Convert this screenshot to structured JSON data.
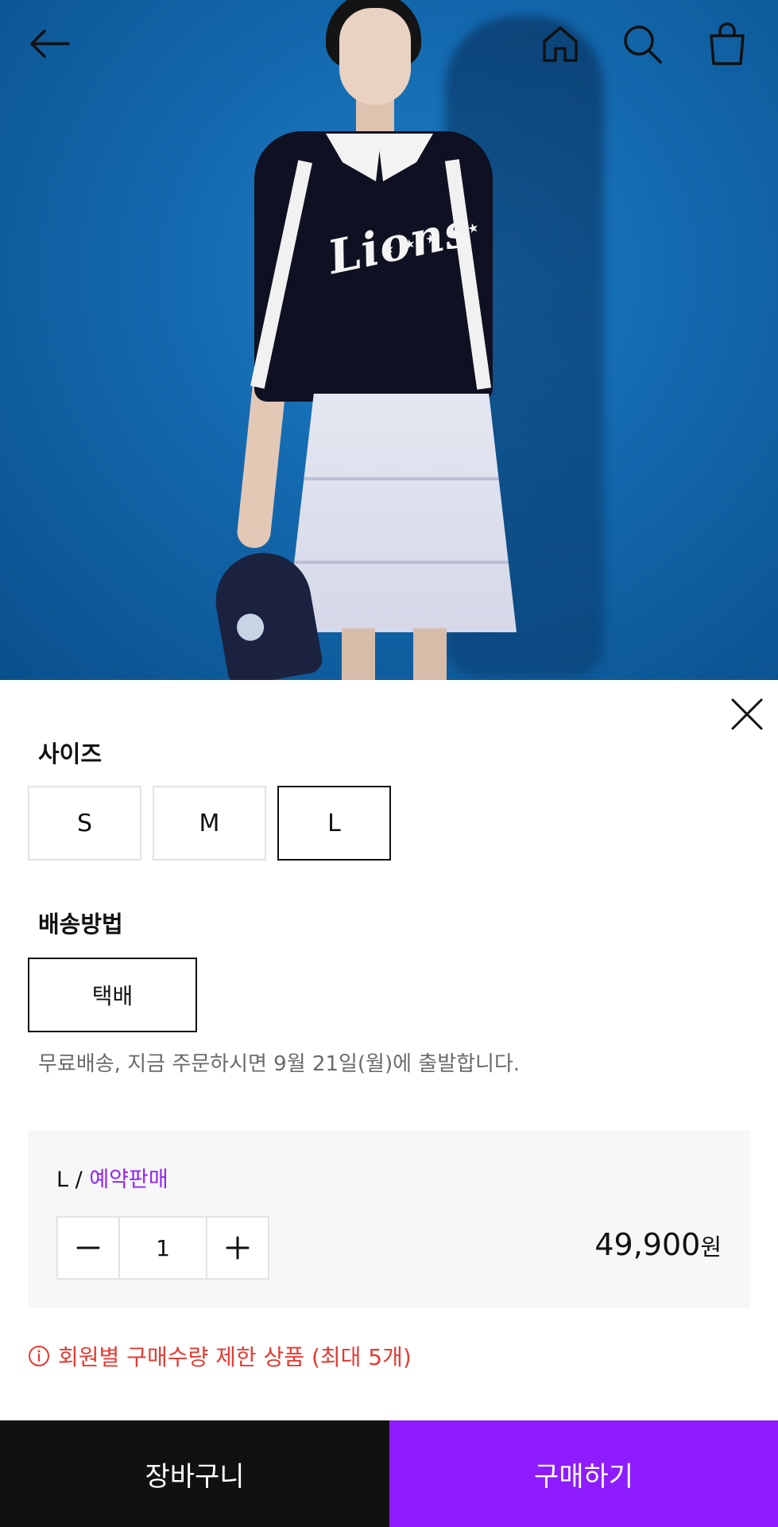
{
  "header": {
    "icons": [
      "back-arrow-icon",
      "home-icon",
      "search-icon",
      "shopping-bag-icon"
    ]
  },
  "hero": {
    "logo_text": "Lions",
    "stars": "★ ★ ★ ★ ★"
  },
  "options": {
    "size_title": "사이즈",
    "sizes": [
      "S",
      "M",
      "L"
    ],
    "selected_size": "L",
    "shipping_title": "배송방법",
    "shipping_option": "택배",
    "shipping_note": "무료배송, 지금 주문하시면 9월 21일(월)에 출발합니다."
  },
  "selection": {
    "label": "L / ",
    "preorder": "예약판매",
    "quantity": "1",
    "price": "49,900",
    "currency": "원"
  },
  "notice": {
    "text": "회원별 구매수량 제한 상품 (최대 5개)"
  },
  "actions": {
    "cart": "장바구니",
    "buy": "구매하기"
  },
  "colors": {
    "accent": "#8e1cff",
    "preorder": "#9126f5",
    "warning": "#e43a33",
    "cart_bg": "#111111"
  }
}
